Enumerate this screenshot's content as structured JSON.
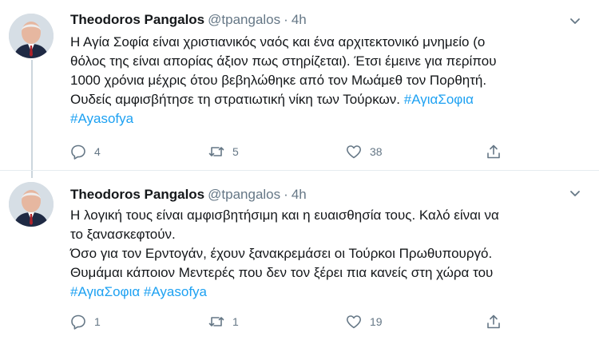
{
  "tweets": [
    {
      "author_name": "Theodoros Pangalos",
      "handle": "@tpangalos",
      "separator": "·",
      "time": "4h",
      "lines": [
        "Η Αγία Σοφία είναι χριστιανικός ναός και ένα αρχιτεκτονικό μνημείο (ο",
        "θόλος της είναι απορίας άξιον πως στηρίζεται). Έτσι έμεινε για περίπου",
        "1000 χρόνια μέχρις ότου βεβηλώθηκε από τον Μωάμεθ τον Πορθητή.",
        "Ουδείς αμφισβήτησε τη στρατιωτική νίκη των Τούρκων."
      ],
      "inline_hashtag": "#ΑγιαΣοφια",
      "last_hashtag": "#Ayasofya",
      "reply_count": "4",
      "retweet_count": "5",
      "like_count": "38"
    },
    {
      "author_name": "Theodoros Pangalos",
      "handle": "@tpangalos",
      "separator": "·",
      "time": "4h",
      "lines": [
        "Η λογική τους είναι αμφισβητήσιμη και η ευαισθησία τους. Καλό είναι να",
        "το ξανασκεφτούν.",
        "Όσο για τον Ερντογάν, έχουν ξανακρεμάσει οι Τούρκοι Πρωθυπουργό.",
        "Θυμάμαι κάποιον Μεντερές που δεν τον ξέρει πια κανείς στη χώρα του"
      ],
      "hashtag_1": "#ΑγιαΣοφια",
      "hashtag_2": "#Ayasofya",
      "reply_count": "1",
      "retweet_count": "1",
      "like_count": "19"
    }
  ],
  "icons": {
    "reply": "reply-icon",
    "retweet": "retweet-icon",
    "like": "heart-icon",
    "share": "share-icon",
    "caret": "chevron-down-icon"
  },
  "colors": {
    "link": "#1da1f2",
    "secondary": "#657786",
    "divider": "#e6ecf0",
    "thread": "#ccd6dd"
  }
}
